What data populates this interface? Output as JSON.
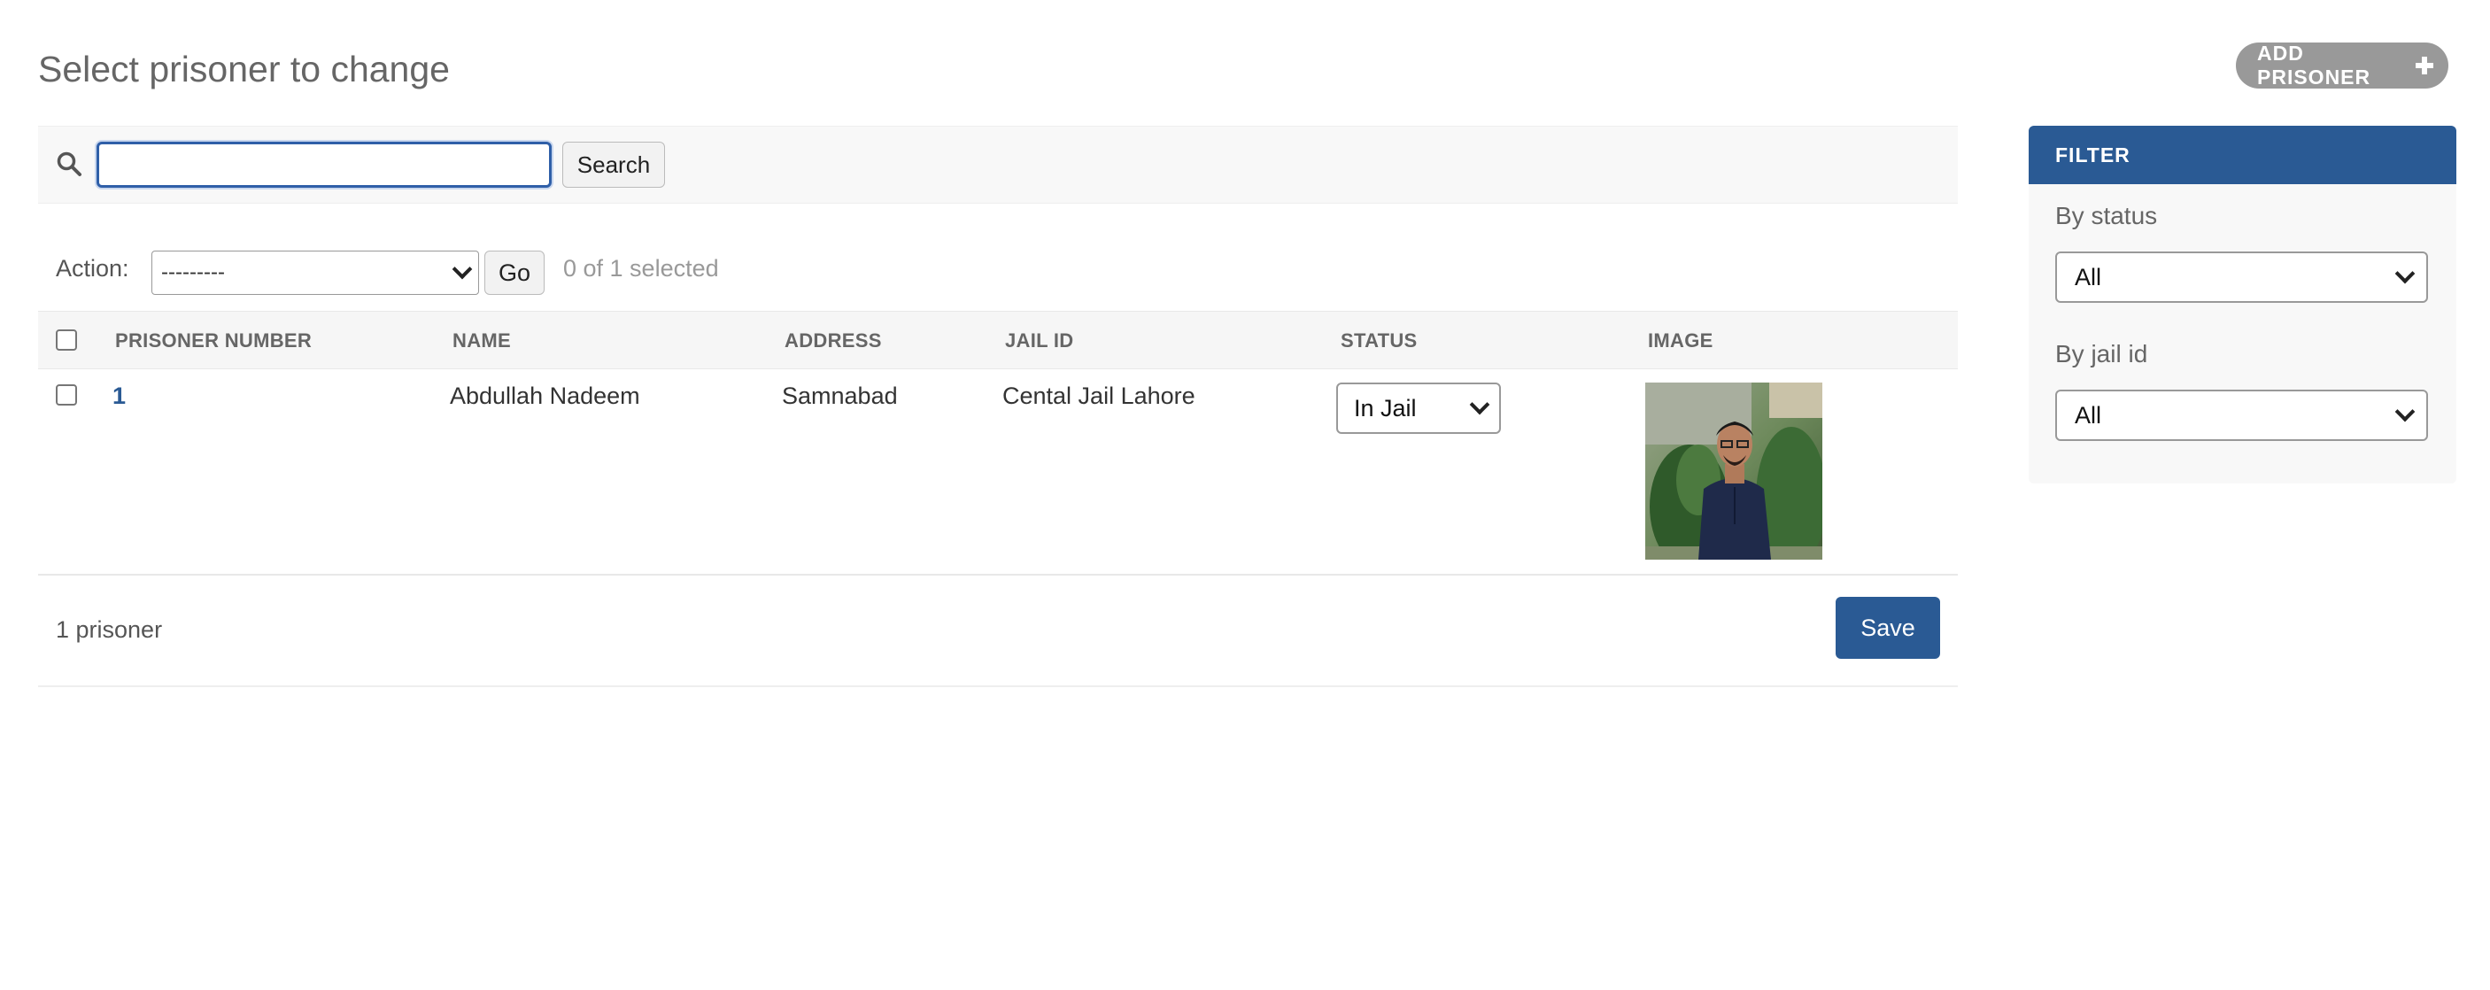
{
  "page": {
    "title": "Select prisoner to change"
  },
  "add_button": {
    "label": "ADD PRISONER",
    "icon": "plus-icon"
  },
  "search": {
    "value": "",
    "placeholder": "",
    "button_label": "Search",
    "icon": "search-icon"
  },
  "actions": {
    "label": "Action:",
    "selected_option": "---------",
    "go_label": "Go",
    "selection_status": "0 of 1 selected"
  },
  "table": {
    "columns": [
      "PRISONER NUMBER",
      "NAME",
      "ADDRESS",
      "JAIL ID",
      "STATUS",
      "IMAGE"
    ],
    "rows": [
      {
        "prisoner_number": "1",
        "name": "Abdullah Nadeem",
        "address": "Samnabad",
        "jail_id": "Cental Jail Lahore",
        "status": "In Jail",
        "image": "prisoner-photo"
      }
    ]
  },
  "footer": {
    "count": "1 prisoner",
    "save_label": "Save"
  },
  "filter": {
    "title": "FILTER",
    "groups": [
      {
        "label": "By status",
        "selected": "All"
      },
      {
        "label": "By jail id",
        "selected": "All"
      }
    ]
  },
  "colors": {
    "primary": "#2a5a94",
    "add_button_bg": "#999999",
    "header_bg": "#f6f6f6",
    "muted_text": "#999999"
  }
}
